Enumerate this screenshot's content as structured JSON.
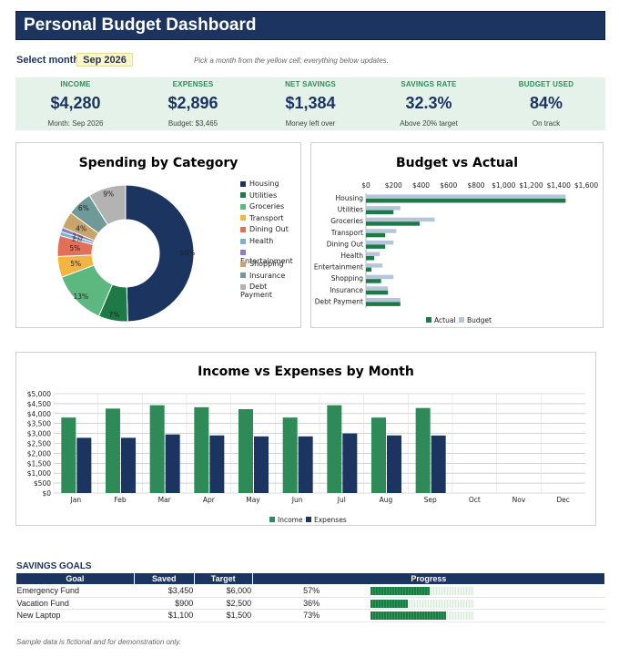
{
  "header": {
    "title": "Personal Budget Dashboard"
  },
  "month_selector": {
    "label": "Select month:",
    "value": "Sep 2026",
    "hint": "Pick a month from the yellow cell; everything below updates."
  },
  "kpis": [
    {
      "label": "INCOME",
      "value": "$4,280",
      "sub": "Month: Sep 2026"
    },
    {
      "label": "EXPENSES",
      "value": "$2,896",
      "sub": "Budget: $3,465"
    },
    {
      "label": "NET SAVINGS",
      "value": "$1,384",
      "sub": "Money left over"
    },
    {
      "label": "SAVINGS RATE",
      "value": "32.3%",
      "sub": "Above 20% target"
    },
    {
      "label": "BUDGET USED",
      "value": "84%",
      "sub": "On track"
    }
  ],
  "colors": {
    "navy": "#1c3460",
    "green": "#2e8b57",
    "light_band": "#e4f2ea",
    "categories": [
      "#1c3460",
      "#1e7a45",
      "#5cb87f",
      "#f2b640",
      "#e0705a",
      "#7db1d8",
      "#8e7cc3",
      "#c9a46a",
      "#6f9a98",
      "#b3b3b3"
    ],
    "actual": "#1e7a45",
    "budget": "#b6c6da",
    "income": "#2e8b57",
    "expenses": "#1c3460"
  },
  "chart_data": [
    {
      "type": "pie",
      "title": "Spending by Category",
      "categories": [
        "Housing",
        "Utilities",
        "Groceries",
        "Transport",
        "Dining Out",
        "Health",
        "Entertainment",
        "Shopping",
        "Insurance",
        "Debt Payment"
      ],
      "values": [
        50,
        7,
        13,
        5,
        5,
        1,
        1,
        4,
        6,
        9
      ],
      "data_labels": [
        "50%",
        "7%",
        "13%",
        "5%",
        "5%",
        "1%",
        "1%",
        "4%",
        "6%",
        "9%"
      ],
      "legend_position": "right"
    },
    {
      "type": "bar",
      "title": "Budget vs Actual",
      "categories": [
        "Housing",
        "Utilities",
        "Groceries",
        "Transport",
        "Dining Out",
        "Health",
        "Entertainment",
        "Shopping",
        "Insurance",
        "Debt Payment"
      ],
      "series": [
        {
          "name": "Budget",
          "values": [
            1450,
            250,
            500,
            220,
            200,
            100,
            120,
            200,
            160,
            250
          ]
        },
        {
          "name": "Actual",
          "values": [
            1450,
            200,
            390,
            140,
            140,
            60,
            40,
            110,
            160,
            250
          ]
        }
      ],
      "x_ticks": [
        "$0",
        "$200",
        "$400",
        "$600",
        "$800",
        "$1,000",
        "$1,200",
        "$1,400",
        "$1,600"
      ],
      "xlim": [
        0,
        1600
      ],
      "legend": [
        "Actual",
        "Budget"
      ],
      "legend_position": "bottom"
    },
    {
      "type": "bar",
      "title": "Income vs Expenses by Month",
      "categories": [
        "Jan",
        "Feb",
        "Mar",
        "Apr",
        "May",
        "Jun",
        "Jul",
        "Aug",
        "Sep",
        "Oct",
        "Nov",
        "Dec"
      ],
      "series": [
        {
          "name": "Income",
          "values": [
            3800,
            4250,
            4420,
            4320,
            4220,
            3800,
            4420,
            3800,
            4280,
            null,
            null,
            null
          ]
        },
        {
          "name": "Expenses",
          "values": [
            2780,
            2780,
            2950,
            2900,
            2850,
            2850,
            3000,
            2900,
            2896,
            null,
            null,
            null
          ]
        }
      ],
      "y_ticks": [
        "$0",
        "$500",
        "$1,000",
        "$1,500",
        "$2,000",
        "$2,500",
        "$3,000",
        "$3,500",
        "$4,000",
        "$4,500",
        "$5,000"
      ],
      "ylim": [
        0,
        5000
      ],
      "legend_position": "bottom"
    }
  ],
  "savings": {
    "title": "SAVINGS GOALS",
    "headers": [
      "Goal",
      "Saved",
      "Target",
      "Progress"
    ],
    "rows": [
      {
        "goal": "Emergency Fund",
        "saved": "$3,450",
        "target": "$6,000",
        "pct": "57%",
        "frac": 0.57
      },
      {
        "goal": "Vacation Fund",
        "saved": "$900",
        "target": "$2,500",
        "pct": "36%",
        "frac": 0.36
      },
      {
        "goal": "New Laptop",
        "saved": "$1,100",
        "target": "$1,500",
        "pct": "73%",
        "frac": 0.73
      }
    ]
  },
  "footnote": "Sample data is fictional and for demonstration only."
}
